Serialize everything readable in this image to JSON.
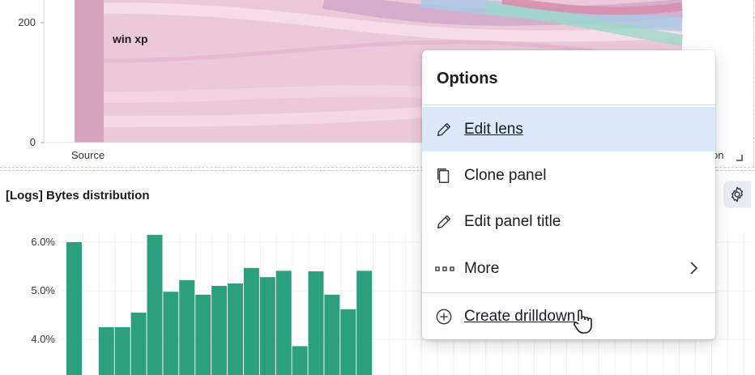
{
  "top_panel": {
    "y_ticks": [
      "200",
      "0"
    ],
    "x_labels": [
      "Source",
      "on"
    ],
    "node_label": "win xp",
    "colors": {
      "node": "#d6a4bd",
      "flow": "#eac4d4"
    }
  },
  "bottom_panel": {
    "title": "[Logs] Bytes distribution",
    "y_ticks": [
      "6.0%",
      "5.0%",
      "4.0%"
    ],
    "bar_color": "#2aa07d"
  },
  "chart_data": {
    "type": "bar",
    "title": "[Logs] Bytes distribution",
    "xlabel": "",
    "ylabel": "",
    "ylim": [
      3.3,
      6.4
    ],
    "values": [
      6.0,
      0,
      4.25,
      4.25,
      4.55,
      6.15,
      4.98,
      5.22,
      4.92,
      5.1,
      5.15,
      5.47,
      5.28,
      5.41,
      3.86,
      5.4,
      4.92,
      4.62,
      5.41
    ]
  },
  "menu": {
    "title": "Options",
    "items": [
      {
        "label": "Edit lens",
        "icon": "pencil-icon"
      },
      {
        "label": "Clone panel",
        "icon": "copy-icon"
      },
      {
        "label": "Edit panel title",
        "icon": "pencil-icon"
      },
      {
        "label": "More",
        "icon": "ellipsis-icon"
      },
      {
        "label": "Create drilldown",
        "icon": "plus-circle-icon"
      }
    ]
  },
  "gear_icon": "gear-icon"
}
